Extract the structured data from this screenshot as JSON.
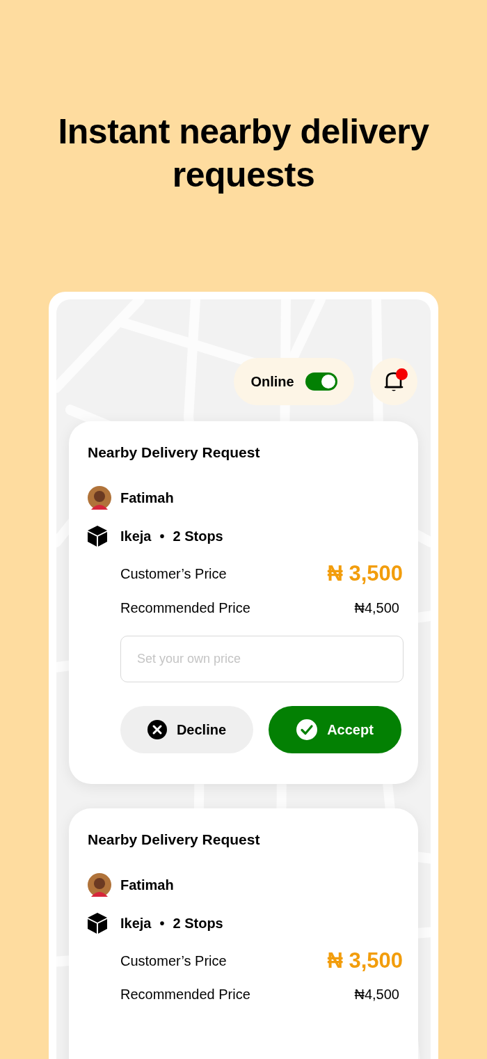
{
  "headline": "Instant nearby delivery requests",
  "status": {
    "label": "Online",
    "on": true
  },
  "notifications": {
    "unread": true
  },
  "requests": [
    {
      "title": "Nearby Delivery Request",
      "customer": "Fatimah",
      "location": "Ikeja",
      "separator": "•",
      "stops": "2 Stops",
      "customer_price_label": "Customer’s Price",
      "customer_price": "₦ 3,500",
      "recommended_price_label": "Recommended Price",
      "recommended_price": "₦4,500",
      "price_field": {
        "placeholder": "Set your own price"
      },
      "buttons": [
        {
          "kind": "decline",
          "label": "Decline"
        },
        {
          "kind": "accept",
          "label": "Accept"
        }
      ]
    },
    {
      "title": "Nearby Delivery Request",
      "customer": "Fatimah",
      "location": "Ikeja",
      "separator": "•",
      "stops": "2 Stops",
      "customer_price_label": "Customer’s Price",
      "customer_price": "₦ 3,500",
      "recommended_price_label": "Recommended Price",
      "recommended_price": "₦4,500"
    }
  ]
}
